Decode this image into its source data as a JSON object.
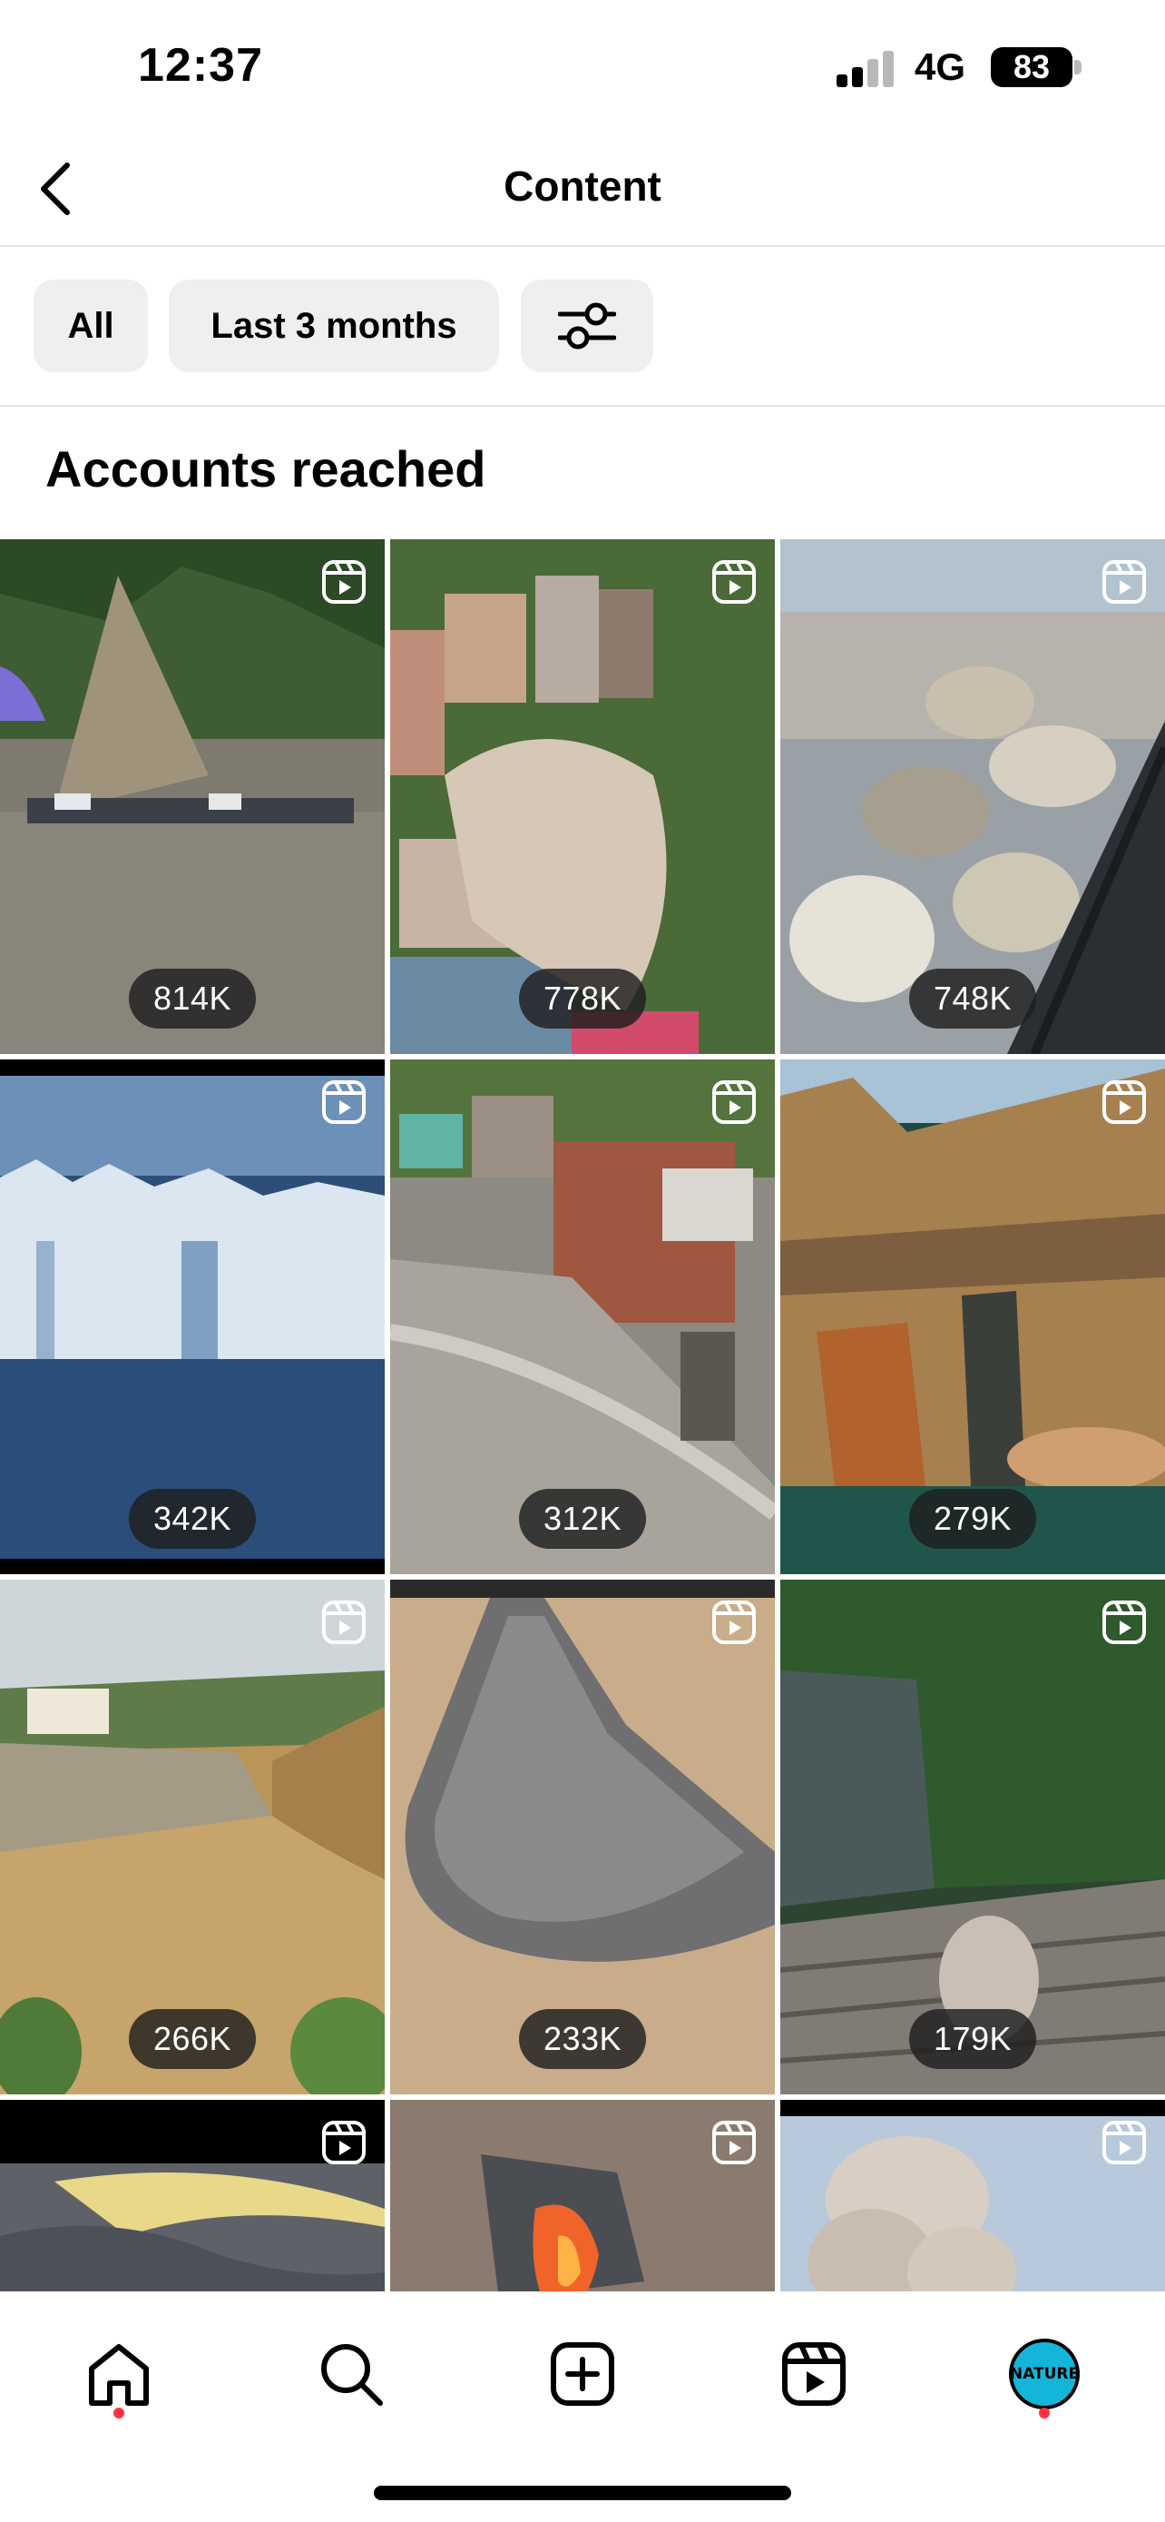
{
  "status_bar": {
    "time": "12:37",
    "network": "4G",
    "battery": "83"
  },
  "header": {
    "title": "Content",
    "back_icon": "chevron-left-icon"
  },
  "filters": {
    "all_label": "All",
    "period_label": "Last 3 months",
    "filter_icon": "sliders-icon"
  },
  "section": {
    "title": "Accounts reached"
  },
  "grid": {
    "items": [
      {
        "count": "814K",
        "subject": "landslide-road"
      },
      {
        "count": "778K",
        "subject": "building-collapse"
      },
      {
        "count": "748K",
        "subject": "ice-boulders-shore"
      },
      {
        "count": "342K",
        "subject": "glacier"
      },
      {
        "count": "312K",
        "subject": "flood-river"
      },
      {
        "count": "279K",
        "subject": "cliff-waterfall"
      },
      {
        "count": "266K",
        "subject": "dam-flood"
      },
      {
        "count": "233K",
        "subject": "fish-on-sand"
      },
      {
        "count": "179K",
        "subject": "animal-dock"
      },
      {
        "count": "",
        "subject": "smoke-sky"
      },
      {
        "count": "",
        "subject": "lava-rock"
      },
      {
        "count": "",
        "subject": "eruption-cloud"
      }
    ]
  },
  "bottom_nav": {
    "items": [
      "home-icon",
      "search-icon",
      "create-icon",
      "reels-icon",
      "profile-avatar"
    ],
    "avatar_text": "NATURE"
  },
  "colors": {
    "notification_dot": "#ff3040",
    "avatar_bg": "#14b6d8",
    "chip_bg": "#efefef"
  }
}
